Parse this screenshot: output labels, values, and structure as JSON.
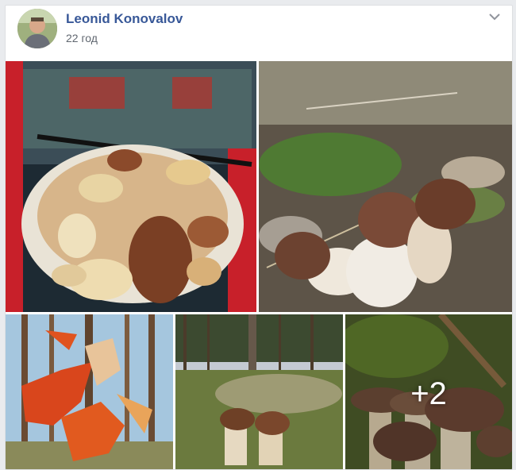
{
  "post": {
    "author_name": "Leonid Konovalov",
    "timestamp": "22 год"
  },
  "icons": {
    "menu": "chevron-down-icon"
  },
  "photos": {
    "more_count": "+2"
  },
  "colors": {
    "author_link": "#385898",
    "timestamp": "#606770",
    "card_border": "#dddfe2"
  }
}
